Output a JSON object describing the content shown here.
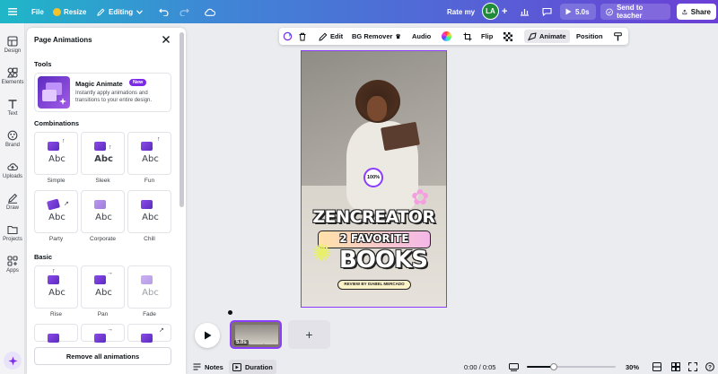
{
  "topbar": {
    "file": "File",
    "resize": "Resize",
    "mode": "Editing",
    "rate": "Rate my",
    "avatar": "LA",
    "play_time": "5.0s",
    "teacher": "Send to teacher",
    "share": "Share"
  },
  "rail": [
    {
      "label": "Design",
      "icon": "design-icon"
    },
    {
      "label": "Elements",
      "icon": "elements-icon"
    },
    {
      "label": "Text",
      "icon": "text-icon"
    },
    {
      "label": "Brand",
      "icon": "brand-icon"
    },
    {
      "label": "Uploads",
      "icon": "uploads-icon"
    },
    {
      "label": "Draw",
      "icon": "draw-icon"
    },
    {
      "label": "Projects",
      "icon": "projects-icon"
    },
    {
      "label": "Apps",
      "icon": "apps-icon"
    }
  ],
  "panel": {
    "title": "Page Animations",
    "tools_heading": "Tools",
    "magic": {
      "title": "Magic Animate",
      "badge": "New",
      "desc": "Instantly apply animations and transitions to your entire design."
    },
    "combinations_heading": "Combinations",
    "combinations": [
      "Simple",
      "Sleek",
      "Fun",
      "Party",
      "Corporate",
      "Chill"
    ],
    "basic_heading": "Basic",
    "basic": [
      "Rise",
      "Pan",
      "Fade"
    ],
    "tile_text": "Abc",
    "remove_label": "Remove all animations"
  },
  "context_toolbar": {
    "edit": "Edit",
    "bg_remover": "BG Remover",
    "audio": "Audio",
    "flip": "Flip",
    "animate": "Animate",
    "position": "Position"
  },
  "design": {
    "zoom_badge": "100%",
    "title_line1": "ZENCREATOR",
    "title_line2": "2 FAVORITE",
    "title_line3": "BOOKS",
    "byline": "REVIEW BY ISABEL MERCADO"
  },
  "timeline": {
    "clip_duration": "5.0s",
    "add_symbol": "+"
  },
  "bottom": {
    "notes": "Notes",
    "duration": "Duration",
    "time": "0:00 / 0:05",
    "zoom": "30%",
    "zoom_fraction": 0.3
  },
  "colors": {
    "accent": "#8b3dff",
    "share_bg": "#ffffff",
    "avatar_bg": "#1f8a3a"
  }
}
